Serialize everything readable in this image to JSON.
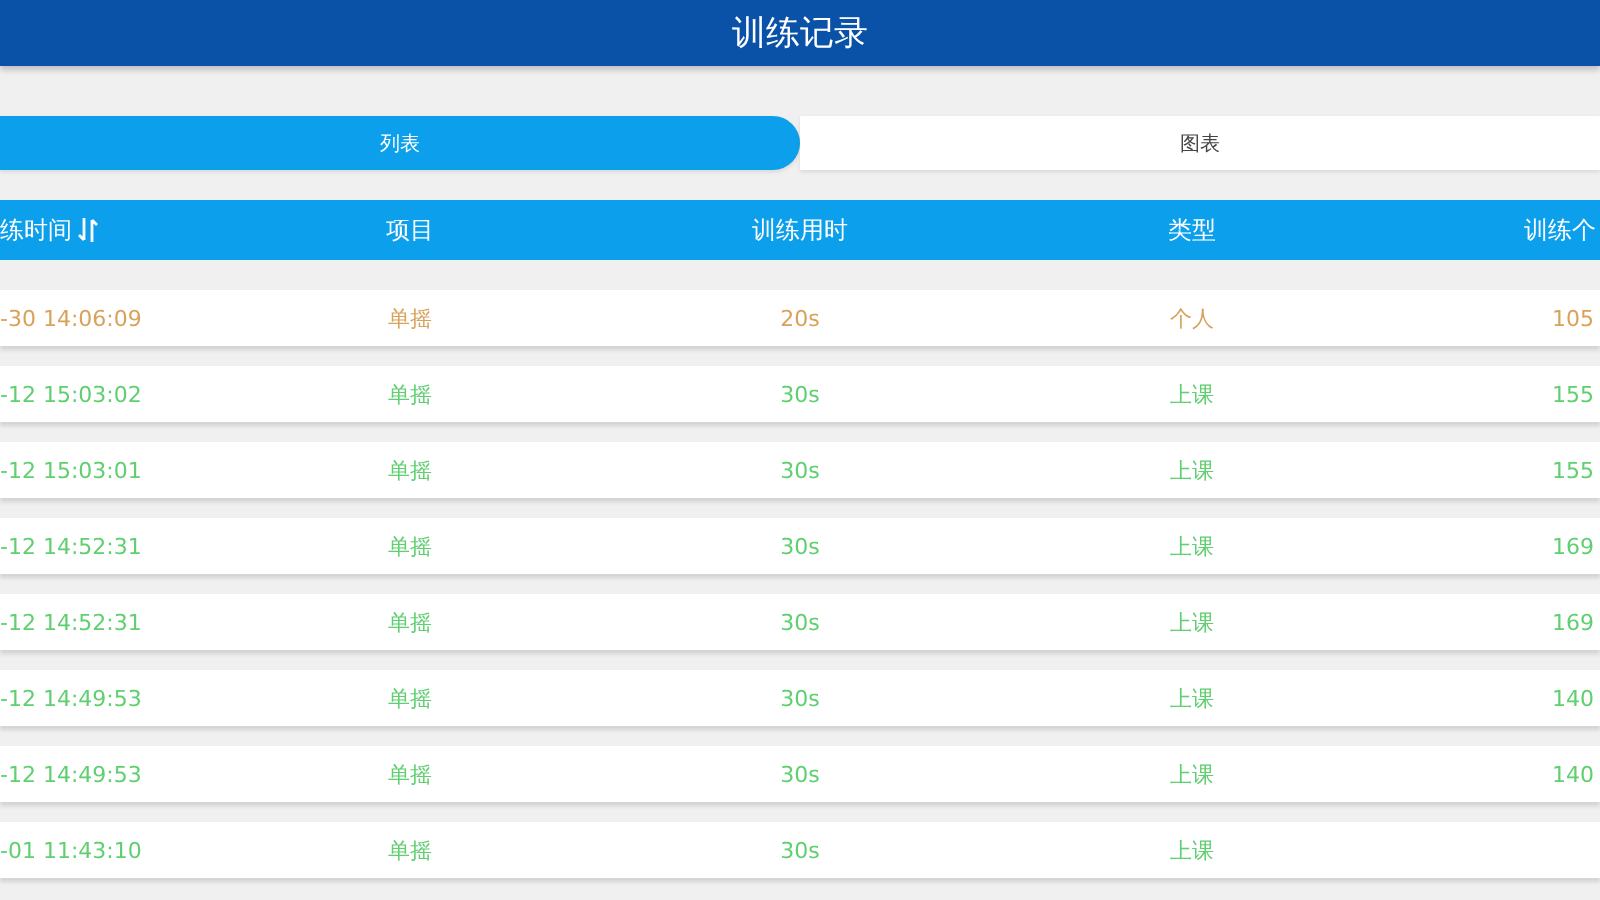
{
  "header": {
    "title": "训练记录"
  },
  "tabs": [
    {
      "label": "列表",
      "selected": true
    },
    {
      "label": "图表",
      "selected": false
    }
  ],
  "table": {
    "columns": [
      "练时间",
      "项目",
      "训练用时",
      "类型",
      "训练个"
    ],
    "rows": [
      {
        "time": "-30 14:06:09",
        "item": "单摇",
        "duration": "20s",
        "type": "个人",
        "count": "105",
        "color": "#d9a25a"
      },
      {
        "time": "-12 15:03:02",
        "item": "单摇",
        "duration": "30s",
        "type": "上课",
        "count": "155",
        "color": "#5fcf6f"
      },
      {
        "time": "-12 15:03:01",
        "item": "单摇",
        "duration": "30s",
        "type": "上课",
        "count": "155",
        "color": "#5fcf6f"
      },
      {
        "time": "-12 14:52:31",
        "item": "单摇",
        "duration": "30s",
        "type": "上课",
        "count": "169",
        "color": "#5fcf6f"
      },
      {
        "time": "-12 14:52:31",
        "item": "单摇",
        "duration": "30s",
        "type": "上课",
        "count": "169",
        "color": "#5fcf6f"
      },
      {
        "time": "-12 14:49:53",
        "item": "单摇",
        "duration": "30s",
        "type": "上课",
        "count": "140",
        "color": "#5fcf6f"
      },
      {
        "time": "-12 14:49:53",
        "item": "单摇",
        "duration": "30s",
        "type": "上课",
        "count": "140",
        "color": "#5fcf6f"
      },
      {
        "time": "-01 11:43:10",
        "item": "单摇",
        "duration": "30s",
        "type": "上课",
        "color": "#5fcf6f"
      }
    ]
  }
}
